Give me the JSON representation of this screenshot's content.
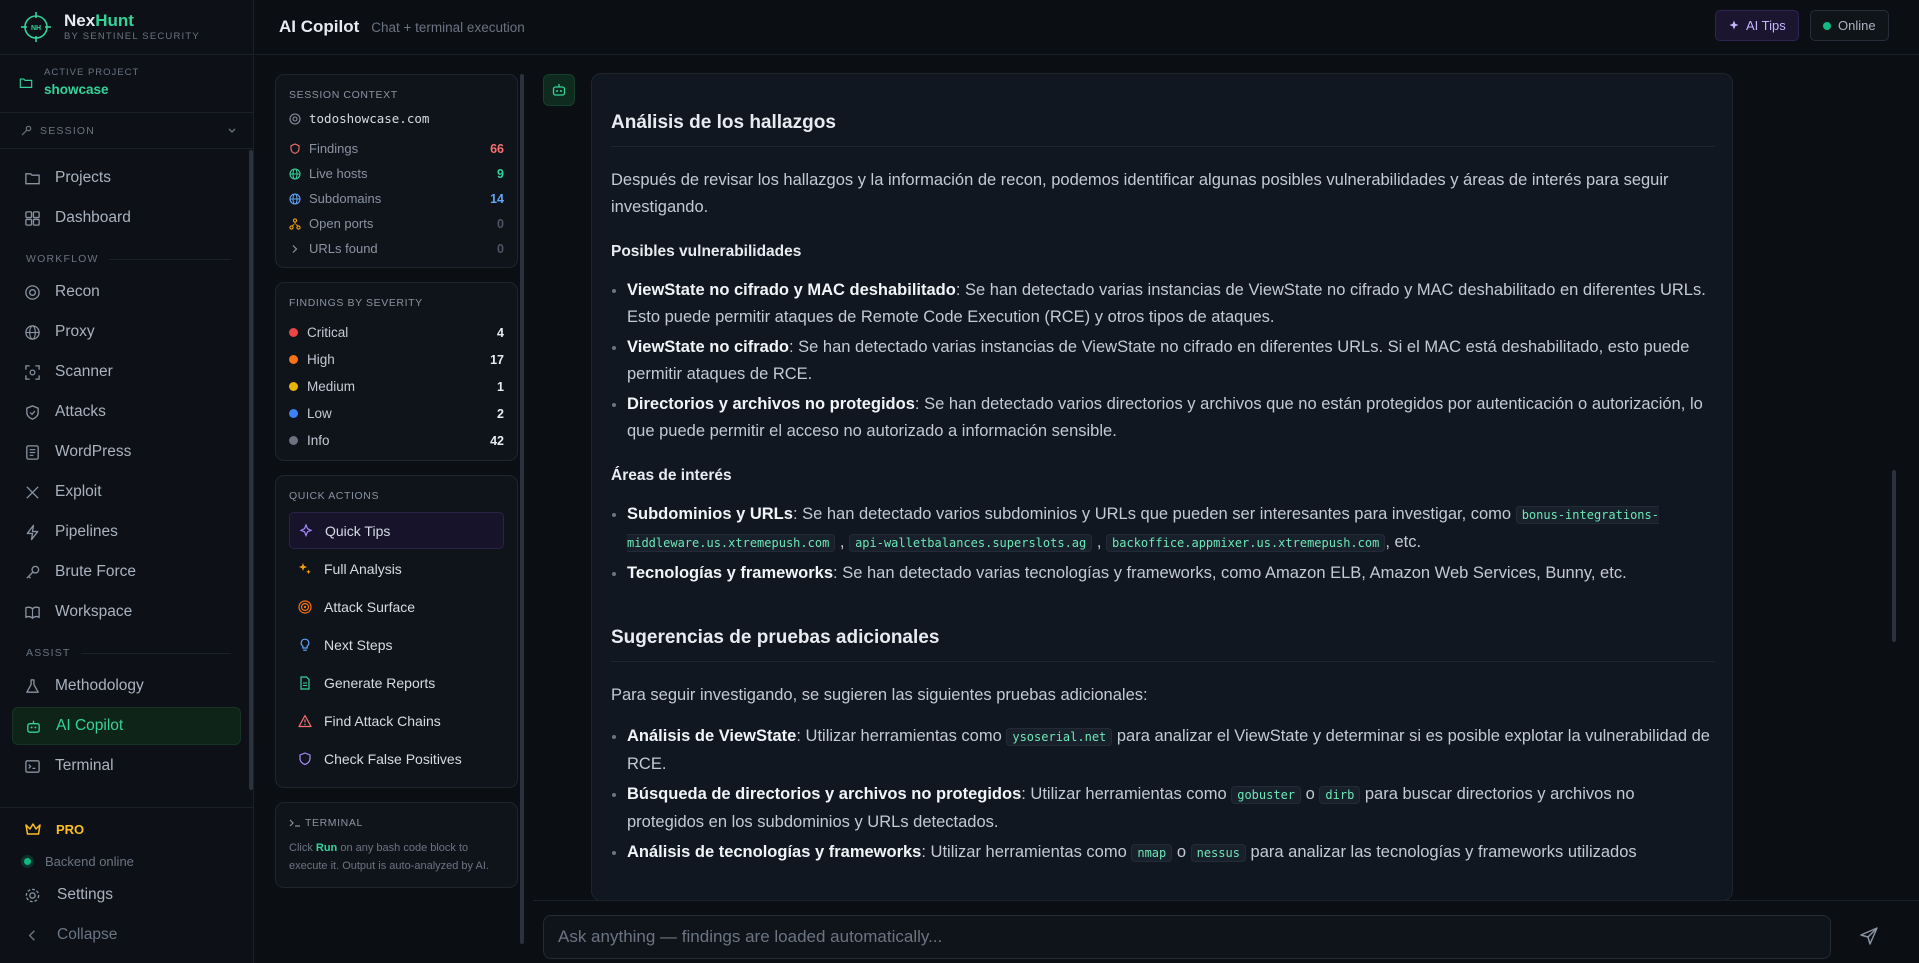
{
  "brand": {
    "name_a": "Nex",
    "name_b": "Hunt",
    "subtitle": "BY SENTINEL SECURITY",
    "logo_text": "NH"
  },
  "project": {
    "label": "ACTIVE PROJECT",
    "name": "showcase"
  },
  "session": {
    "label": "SESSION"
  },
  "nav": {
    "main": [
      {
        "label": "Projects"
      },
      {
        "label": "Dashboard"
      }
    ],
    "workflow_label": "WORKFLOW",
    "workflow": [
      {
        "label": "Recon"
      },
      {
        "label": "Proxy"
      },
      {
        "label": "Scanner"
      },
      {
        "label": "Attacks"
      },
      {
        "label": "WordPress"
      },
      {
        "label": "Exploit"
      },
      {
        "label": "Pipelines"
      },
      {
        "label": "Brute Force"
      },
      {
        "label": "Workspace"
      }
    ],
    "assist_label": "ASSIST",
    "assist": [
      {
        "label": "Methodology"
      },
      {
        "label": "AI Copilot"
      },
      {
        "label": "Terminal"
      }
    ]
  },
  "sidebar_bottom": {
    "pro": "PRO",
    "backend": "Backend online",
    "settings": "Settings",
    "collapse": "Collapse"
  },
  "topbar": {
    "title": "AI Copilot",
    "subtitle": "Chat + terminal execution",
    "tips": "AI Tips",
    "status": "Online"
  },
  "context": {
    "header": "SESSION CONTEXT",
    "domain": "todoshowcase.com",
    "stats": [
      {
        "label": "Findings",
        "value": "66",
        "color": "#f87171"
      },
      {
        "label": "Live hosts",
        "value": "9",
        "color": "#34d399"
      },
      {
        "label": "Subdomains",
        "value": "14",
        "color": "#60a5fa"
      },
      {
        "label": "Open ports",
        "value": "0",
        "color": "#4b5563"
      },
      {
        "label": "URLs found",
        "value": "0",
        "color": "#4b5563"
      }
    ]
  },
  "severity": {
    "header": "FINDINGS BY SEVERITY",
    "items": [
      {
        "label": "Critical",
        "value": "4",
        "color": "#ef4444"
      },
      {
        "label": "High",
        "value": "17",
        "color": "#f97316"
      },
      {
        "label": "Medium",
        "value": "1",
        "color": "#eab308"
      },
      {
        "label": "Low",
        "value": "2",
        "color": "#3b82f6"
      },
      {
        "label": "Info",
        "value": "42",
        "color": "#6b7280"
      }
    ]
  },
  "quick_actions": {
    "header": "QUICK ACTIONS",
    "items": [
      {
        "label": "Quick Tips",
        "icon": "sparkle-icon"
      },
      {
        "label": "Full Analysis",
        "icon": "sparkle-icon"
      },
      {
        "label": "Attack Surface",
        "icon": "target-icon"
      },
      {
        "label": "Next Steps",
        "icon": "lightbulb-icon"
      },
      {
        "label": "Generate Reports",
        "icon": "file-icon"
      },
      {
        "label": "Find Attack Chains",
        "icon": "warning-icon"
      },
      {
        "label": "Check False Positives",
        "icon": "shield-icon"
      }
    ]
  },
  "terminal_card": {
    "header": "TERMINAL",
    "pre": "Click ",
    "run": "Run",
    "post": " on any bash code block to execute it. Output is auto-analyzed by AI."
  },
  "message": {
    "h_analysis": "Análisis de los hallazgos",
    "intro": "Después de revisar los hallazgos y la información de recon, podemos identificar algunas posibles vulnerabilidades y áreas de interés para seguir investigando.",
    "h_vulns": "Posibles vulnerabilidades",
    "vulns": [
      {
        "title": "ViewState no cifrado y MAC deshabilitado",
        "text": ": Se han detectado varias instancias de ViewState no cifrado y MAC deshabilitado en diferentes URLs. Esto puede permitir ataques de Remote Code Execution (RCE) y otros tipos de ataques."
      },
      {
        "title": "ViewState no cifrado",
        "text": ": Se han detectado varias instancias de ViewState no cifrado en diferentes URLs. Si el MAC está deshabilitado, esto puede permitir ataques de RCE."
      },
      {
        "title": "Directorios y archivos no protegidos",
        "text": ": Se han detectado varios directorios y archivos que no están protegidos por autenticación o autorización, lo que puede permitir el acceso no autorizado a información sensible."
      }
    ],
    "h_areas": "Áreas de interés",
    "areas": {
      "sub_title": "Subdominios y URLs",
      "sub_text": ": Se han detectado varios subdominios y URLs que pueden ser interesantes para investigar, como ",
      "codes": [
        "bonus-integrations-middleware.us.xtremepush.com",
        "api-walletbalances.superslots.ag",
        "backoffice.appmixer.us.xtremepush.com"
      ],
      "sep": " , ",
      "etc": ", etc.",
      "tech_title": "Tecnologías y frameworks",
      "tech_text": ": Se han detectado varias tecnologías y frameworks, como Amazon ELB, Amazon Web Services, Bunny, etc."
    },
    "h_tests": "Sugerencias de pruebas adicionales",
    "tests_intro": "Para seguir investigando, se sugieren las siguientes pruebas adicionales:",
    "tests": {
      "t1_title": "Análisis de ViewState",
      "t1_a": ": Utilizar herramientas como ",
      "t1_code": "ysoserial.net",
      "t1_b": " para analizar el ViewState y determinar si es posible explotar la vulnerabilidad de RCE.",
      "t2_title": "Búsqueda de directorios y archivos no protegidos",
      "t2_a": ": Utilizar herramientas como ",
      "t2_code1": "gobuster",
      "t2_or": " o ",
      "t2_code2": "dirb",
      "t2_b": " para buscar directorios y archivos no protegidos en los subdominios y URLs detectados.",
      "t3_title": "Análisis de tecnologías y frameworks",
      "t3_a": ": Utilizar herramientas como ",
      "t3_code1": "nmap",
      "t3_or": " o ",
      "t3_code2": "nessus",
      "t3_b": " para analizar las tecnologías y frameworks utilizados"
    }
  },
  "composer": {
    "placeholder": "Ask anything — findings are loaded automatically..."
  }
}
